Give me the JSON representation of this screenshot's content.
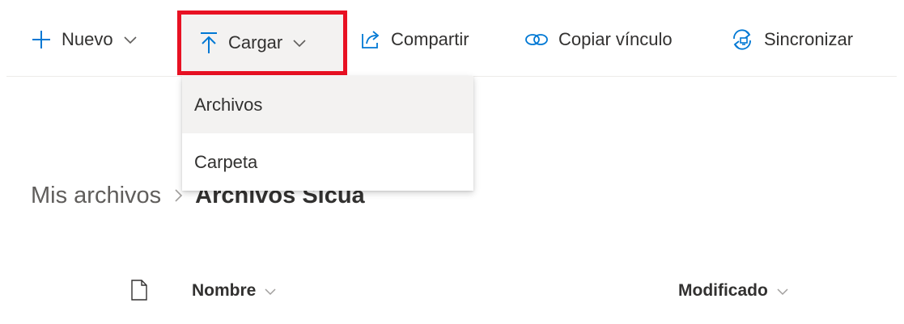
{
  "commandbar": {
    "new_label": "Nuevo",
    "upload_label": "Cargar",
    "share_label": "Compartir",
    "copy_link_label": "Copiar vínculo",
    "sync_label": "Sincronizar"
  },
  "upload_menu": {
    "items": [
      {
        "label": "Archivos"
      },
      {
        "label": "Carpeta"
      }
    ]
  },
  "breadcrumb": {
    "root": "Mis archivos",
    "current": "Archivos Sicua"
  },
  "file_list": {
    "columns": [
      {
        "label": "Nombre"
      },
      {
        "label": "Modificado"
      }
    ]
  },
  "colors": {
    "accent": "#0078d4",
    "highlight": "#e81123",
    "hover_bg": "#f3f2f1"
  },
  "icons": {
    "new": "plus-icon",
    "upload": "upload-arrow-icon",
    "share": "share-icon",
    "copy_link": "link-icon",
    "sync": "sync-icon",
    "file_type": "document-icon"
  }
}
